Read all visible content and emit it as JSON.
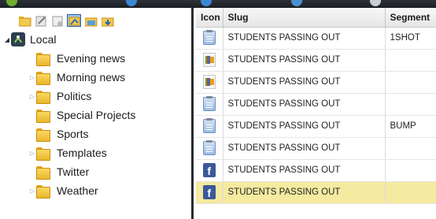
{
  "tree": {
    "root": {
      "label": "Local",
      "expanded": true
    },
    "folders": [
      {
        "label": "Evening news",
        "has_children": false
      },
      {
        "label": "Morning news",
        "has_children": true
      },
      {
        "label": "Politics",
        "has_children": true
      },
      {
        "label": "Special Projects",
        "has_children": false
      },
      {
        "label": "Sports",
        "has_children": false
      },
      {
        "label": "Templates",
        "has_children": true
      },
      {
        "label": "Twitter",
        "has_children": false
      },
      {
        "label": "Weather",
        "has_children": true
      }
    ]
  },
  "grid": {
    "columns": [
      "Icon",
      "Slug",
      "Segment"
    ],
    "rows": [
      {
        "icon": "clipboard-icon",
        "slug": "STUDENTS PASSING OUT",
        "segment": "1SHOT",
        "selected": false
      },
      {
        "icon": "character-gen-icon",
        "slug": "STUDENTS PASSING OUT",
        "segment": "",
        "selected": false
      },
      {
        "icon": "character-gen-icon",
        "slug": "STUDENTS PASSING OUT",
        "segment": "",
        "selected": false
      },
      {
        "icon": "clipboard-icon",
        "slug": "STUDENTS PASSING OUT",
        "segment": "",
        "selected": false
      },
      {
        "icon": "clipboard-icon",
        "slug": "STUDENTS PASSING OUT",
        "segment": "BUMP",
        "selected": false
      },
      {
        "icon": "clipboard-icon",
        "slug": "STUDENTS PASSING OUT",
        "segment": "",
        "selected": false
      },
      {
        "icon": "facebook-icon",
        "slug": "STUDENTS PASSING OUT",
        "segment": "",
        "selected": false
      },
      {
        "icon": "facebook-icon",
        "slug": "STUDENTS PASSING OUT",
        "segment": "",
        "selected": true
      }
    ]
  },
  "colors": {
    "selected_row": "#f4eaa0",
    "folder": "#ebb62c",
    "divider": "#27292d"
  }
}
